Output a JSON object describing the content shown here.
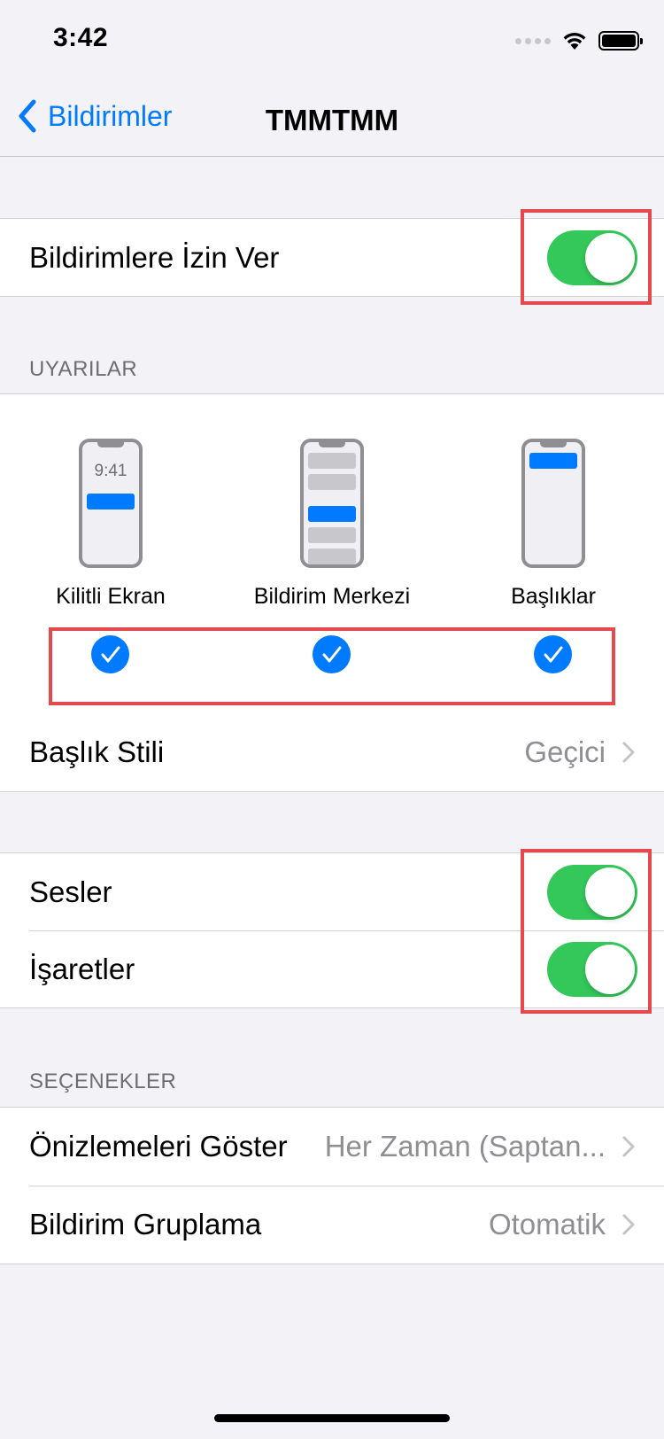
{
  "status_bar": {
    "time": "3:42"
  },
  "nav": {
    "back_label": "Bildirimler",
    "title": "TMMTMM"
  },
  "allow": {
    "label": "Bildirimlere İzin Ver",
    "enabled": true
  },
  "alerts": {
    "header": "UYARILAR",
    "styles": [
      {
        "label": "Kilitli Ekran",
        "preview_time": "9:41",
        "checked": true
      },
      {
        "label": "Bildirim Merkezi",
        "checked": true
      },
      {
        "label": "Başlıklar",
        "checked": true
      }
    ],
    "banner_style": {
      "label": "Başlık Stili",
      "value": "Geçici"
    }
  },
  "sounds": {
    "label": "Sesler",
    "enabled": true
  },
  "badges": {
    "label": "İşaretler",
    "enabled": true
  },
  "options": {
    "header": "SEÇENEKLER",
    "show_previews": {
      "label": "Önizlemeleri Göster",
      "value": "Her Zaman (Saptan..."
    },
    "grouping": {
      "label": "Bildirim Gruplama",
      "value": "Otomatik"
    }
  },
  "colors": {
    "accent": "#007aff",
    "toggle_on": "#34c759",
    "highlight": "#e5484d",
    "background": "#f2f2f7"
  }
}
